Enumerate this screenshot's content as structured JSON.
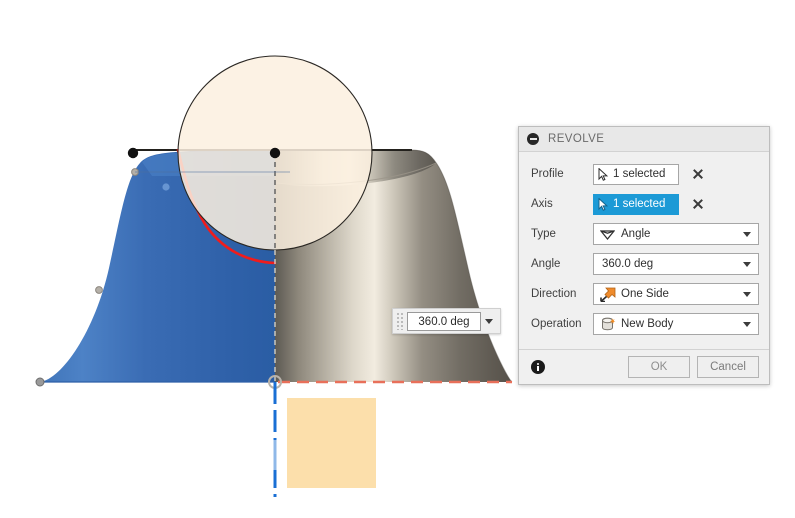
{
  "app": {
    "context": "3D CAD modeling viewport with Revolve feature dialog"
  },
  "canvas": {
    "angle_manipulator": {
      "value": "360.0 deg",
      "grip_name": "drag-grip",
      "dropdown_icon": "chevron-down-icon"
    },
    "geometry": {
      "body_color": "#3a6eb5",
      "shaded_color": "#7d776d",
      "sketch_circle_fill": "#fbf0e0",
      "sketch_rect_fill": "#fcdfab",
      "profile_edge_color": "#ee2222",
      "axis_color": "#1a6fd4",
      "construction_color": "#e8705a"
    }
  },
  "dialog": {
    "title": "REVOLVE",
    "collapse_icon": "collapse-minus-icon",
    "rows": [
      {
        "label": "Profile",
        "type": "selection",
        "value": "1 selected",
        "icon": "select-cursor-icon",
        "active": false,
        "clear_icon": "close-x-icon"
      },
      {
        "label": "Axis",
        "type": "selection",
        "value": "1 selected",
        "icon": "select-cursor-icon",
        "active": true,
        "clear_icon": "close-x-icon"
      },
      {
        "label": "Type",
        "type": "combo",
        "value": "Angle",
        "icon": "angle-wedge-icon",
        "dropdown_icon": "chevron-down-icon"
      },
      {
        "label": "Angle",
        "type": "combo-plain",
        "value": "360.0 deg",
        "icon": "",
        "dropdown_icon": "chevron-down-icon"
      },
      {
        "label": "Direction",
        "type": "combo",
        "value": "One Side",
        "icon": "one-side-arrow-icon",
        "dropdown_icon": "chevron-down-icon"
      },
      {
        "label": "Operation",
        "type": "combo",
        "value": "New Body",
        "icon": "new-body-icon",
        "dropdown_icon": "chevron-down-icon"
      }
    ],
    "footer": {
      "info_icon": "info-icon",
      "ok_label": "OK",
      "cancel_label": "Cancel"
    }
  }
}
